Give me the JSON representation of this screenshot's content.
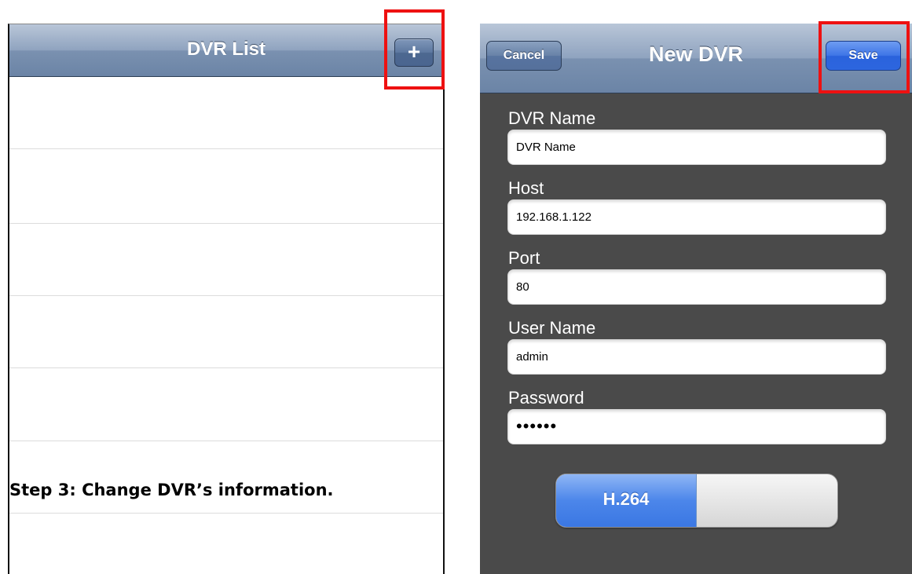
{
  "left_screen": {
    "title": "DVR List",
    "add_button_label": "+"
  },
  "caption": {
    "text": "Step 3: Change DVR’s information."
  },
  "right_screen": {
    "title": "New DVR",
    "cancel_label": "Cancel",
    "save_label": "Save",
    "fields": [
      {
        "label": "DVR Name",
        "value": "DVR Name"
      },
      {
        "label": "Host",
        "value": "192.168.1.122"
      },
      {
        "label": "Port",
        "value": "80"
      },
      {
        "label": "User Name",
        "value": "admin"
      },
      {
        "label": "Password",
        "value": "••••••"
      }
    ],
    "codec_toggle": {
      "label": "H.264",
      "state": "on"
    }
  },
  "colors": {
    "highlight": "#ee1111",
    "navbar": "#7a91b0",
    "save_button": "#2a62dc",
    "form_background": "#4a4a4a"
  }
}
